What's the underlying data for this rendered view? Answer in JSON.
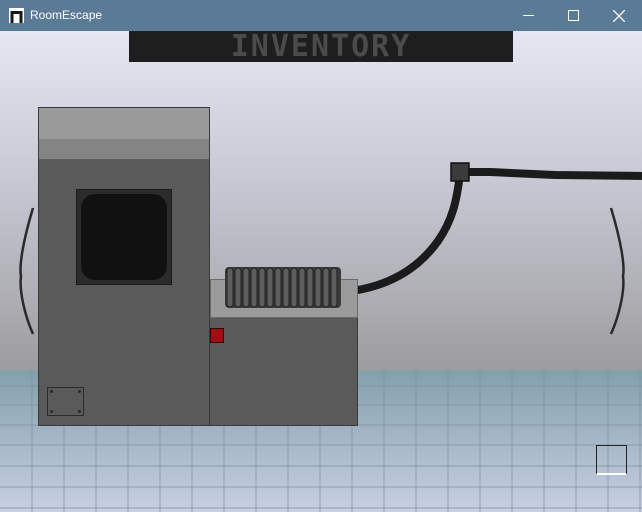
{
  "window": {
    "title": "RoomEscape",
    "controls": {
      "minimize": "minimize-icon",
      "maximize": "maximize-icon",
      "close": "close-icon"
    }
  },
  "inventory": {
    "label": "INVENTORY"
  },
  "scene": {
    "navigation": {
      "left": "nav-left-arrow",
      "right": "nav-right-arrow"
    },
    "colors": {
      "button_red": "#a10f14",
      "machine": "#5a5a5a",
      "cable": "#1b1b1b"
    }
  }
}
